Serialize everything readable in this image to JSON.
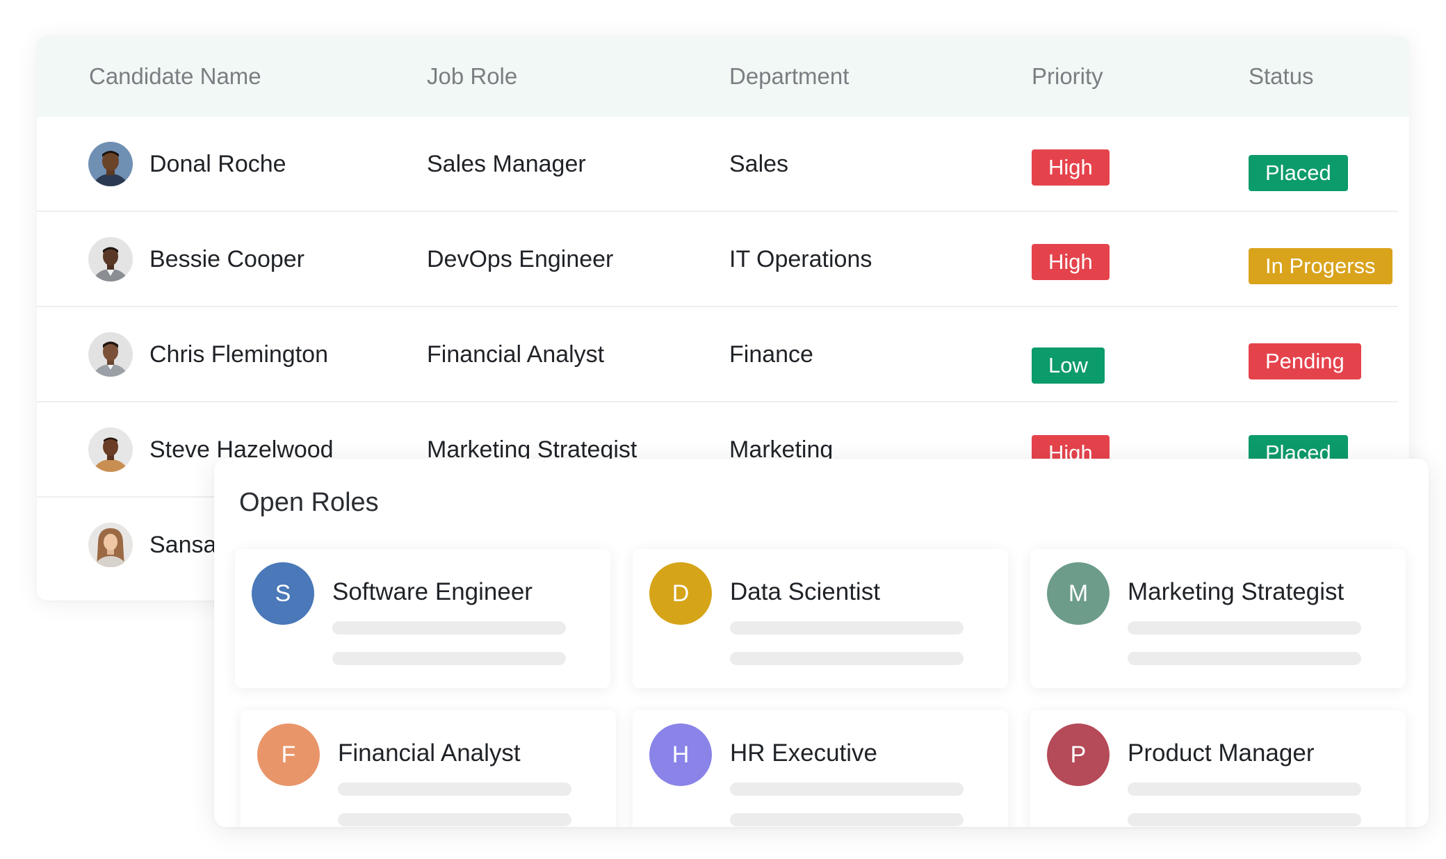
{
  "table": {
    "headers": {
      "name": "Candidate Name",
      "role": "Job Role",
      "department": "Department",
      "priority": "Priority",
      "status": "Status"
    },
    "rows": [
      {
        "name": "Donal Roche",
        "role": "Sales Manager",
        "department": "Sales",
        "priority": "High",
        "status": "Placed"
      },
      {
        "name": "Bessie Cooper",
        "role": "DevOps Engineer",
        "department": "IT Operations",
        "priority": "High",
        "status": "In Progerss"
      },
      {
        "name": "Chris Flemington",
        "role": "Financial Analyst",
        "department": "Finance",
        "priority": "Low",
        "status": "Pending"
      },
      {
        "name": "Steve Hazelwood",
        "role": "Marketing Strategist",
        "department": "Marketing",
        "priority": "High",
        "status": "Placed"
      },
      {
        "name": "Sansa",
        "role": "",
        "department": "",
        "priority": "",
        "status": ""
      }
    ]
  },
  "open_roles": {
    "title": "Open Roles",
    "cards": [
      {
        "initial": "S",
        "title": "Software Engineer",
        "color": "#4a78b8"
      },
      {
        "initial": "D",
        "title": "Data Scientist",
        "color": "#d6a419"
      },
      {
        "initial": "M",
        "title": "Marketing Strategist",
        "color": "#6d9c8a"
      },
      {
        "initial": "F",
        "title": "Financial Analyst",
        "color": "#e9956a"
      },
      {
        "initial": "H",
        "title": "HR Executive",
        "color": "#8a84e8"
      },
      {
        "initial": "P",
        "title": "Product Manager",
        "color": "#b54a58"
      }
    ]
  },
  "colors": {
    "high": "#e5434c",
    "low": "#0c9b6a",
    "placed": "#0c9b6a",
    "in_progress": "#d9a31c",
    "pending": "#e5434c",
    "header_bg": "#f2f8f5"
  }
}
